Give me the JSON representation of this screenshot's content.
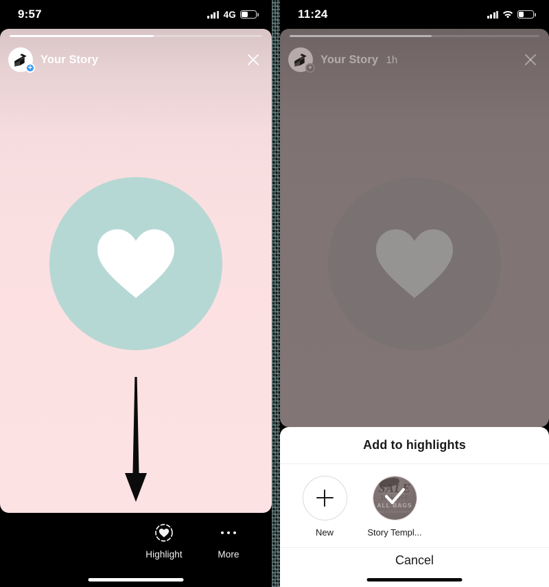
{
  "left_phone": {
    "status": {
      "time": "9:57",
      "network": "4G",
      "signal_icon": "cellular-bars-icon",
      "battery_icon": "battery-icon",
      "battery_level": 38
    },
    "story": {
      "progress_percent": 57,
      "avatar_icon": "profile-avatar-icon",
      "add_badge_icon": "plus-badge-icon",
      "username": "Your Story",
      "timestamp": "",
      "close_icon": "close-icon",
      "background_color": "#fbe0e1",
      "medallion_color": "#b6d8d4",
      "heart_icon": "heart-icon",
      "heart_color": "#ffffff",
      "annotation_icon": "down-arrow-annotation-icon"
    },
    "toolbar": {
      "items": [
        {
          "icon": "highlight-heart-icon",
          "label": "Highlight"
        },
        {
          "icon": "more-dots-icon",
          "label": "More"
        }
      ]
    },
    "home_indicator": "home-indicator"
  },
  "right_phone": {
    "status": {
      "time": "11:24",
      "network": "wifi",
      "signal_icon": "cellular-bars-icon",
      "wifi_icon": "wifi-icon",
      "battery_icon": "battery-icon",
      "battery_level": 32
    },
    "story": {
      "progress_percent": 57,
      "avatar_icon": "profile-avatar-icon",
      "add_badge_icon": "plus-badge-icon",
      "username": "Your Story",
      "timestamp": "1h",
      "close_icon": "close-icon",
      "background_color": "#7d7070",
      "medallion_color": "#7a7272",
      "heart_icon": "heart-icon",
      "heart_color": "#969393"
    },
    "sheet": {
      "title": "Add to highlights",
      "highlights": [
        {
          "icon": "plus-icon",
          "label": "New",
          "selected": false
        },
        {
          "icon": "story-cover-thumbnail",
          "label": "Story Templ...",
          "selected": true,
          "cover_text": {
            "line1": "SALE",
            "line2": "30% OFF",
            "line3": "ALL BAGS",
            "line4": "AND ACCESSORIES"
          },
          "check_icon": "checkmark-icon"
        }
      ],
      "cancel_label": "Cancel"
    },
    "home_indicator": "home-indicator"
  }
}
